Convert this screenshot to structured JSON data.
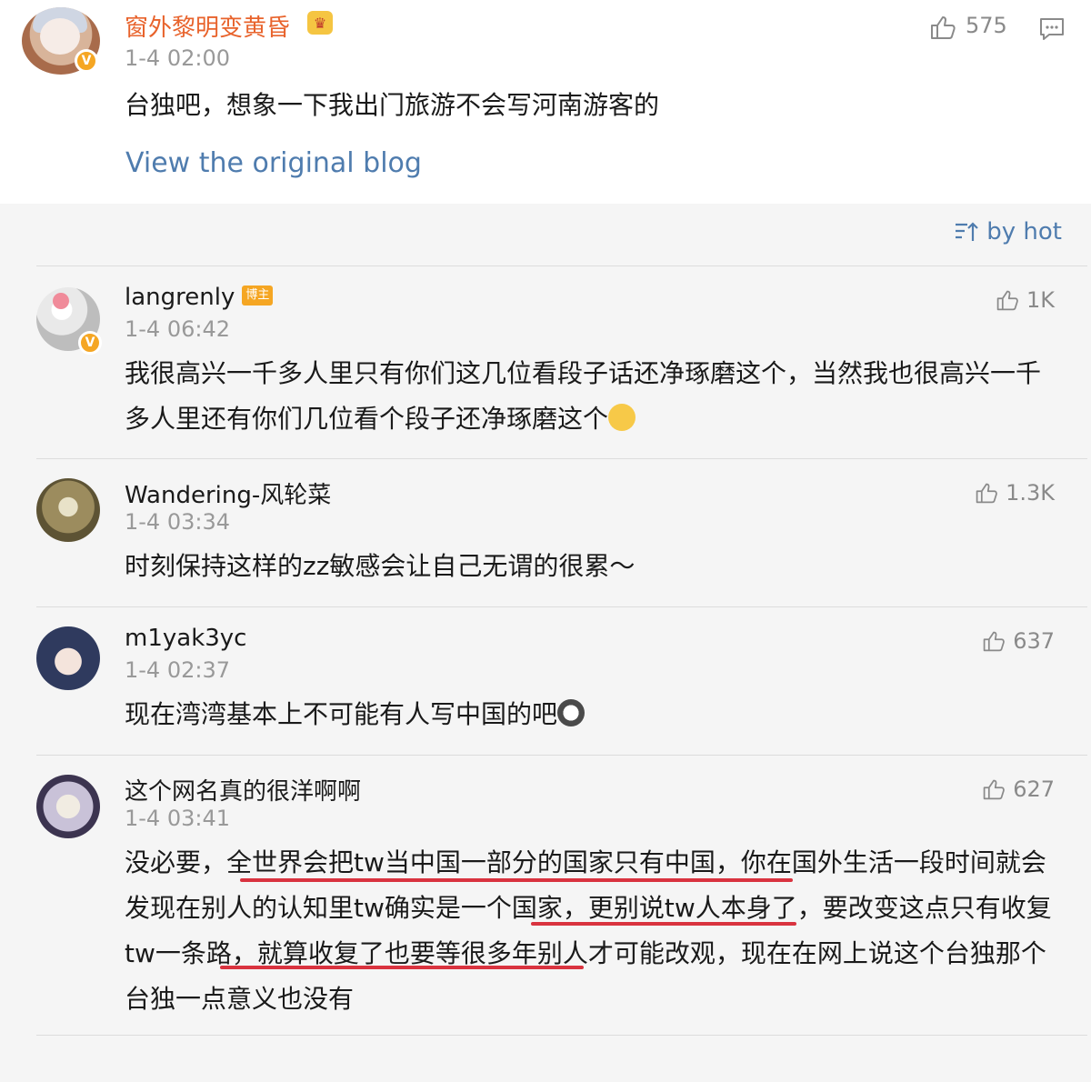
{
  "original_post": {
    "username": "窗外黎明变黄昏",
    "crown_emoji": "♛",
    "verified_mark": "V",
    "time": "1-4 02:00",
    "text": "台独吧，想象一下我出门旅游不会写河南游客的",
    "like_count": "575",
    "view_original_label": "View the original blog"
  },
  "sort": {
    "label": "by hot",
    "icon": "sort-icon"
  },
  "comments": [
    {
      "username": "langrenly",
      "badge": "博主",
      "verified_mark": "V",
      "time": "1-4 06:42",
      "text": "我很高兴一千多人里只有你们这几位看段子话还净琢磨这个，当然我也很高兴一千多人里还有你们几位看个段子还净琢磨这个",
      "likes": "1K"
    },
    {
      "username": "Wandering-风轮菜",
      "time": "1-4 03:34",
      "text": "时刻保持这样的zz敏感会让自己无谓的很累～",
      "likes": "1.3K"
    },
    {
      "username": "m1yak3yc",
      "time": "1-4 02:37",
      "text": "现在湾湾基本上不可能有人写中国的吧",
      "likes": "637"
    },
    {
      "username": "这个网名真的很洋啊啊",
      "time": "1-4 03:41",
      "text": "没必要，全世界会把tw当中国一部分的国家只有中国，你在国外生活一段时间就会发现在别人的认知里tw确实是一个国家，更别说tw人本身了，要改变这点只有收复tw一条路，就算收复了也要等很多年别人才可能改观，现在在网上说这个台独那个台独一点意义也没有",
      "likes": "627"
    }
  ],
  "colors": {
    "username_orange": "#e8632c",
    "link_blue": "#4f7cae",
    "meta_gray": "#999999",
    "underline_red": "#d9333f",
    "badge_orange": "#f5a623"
  }
}
